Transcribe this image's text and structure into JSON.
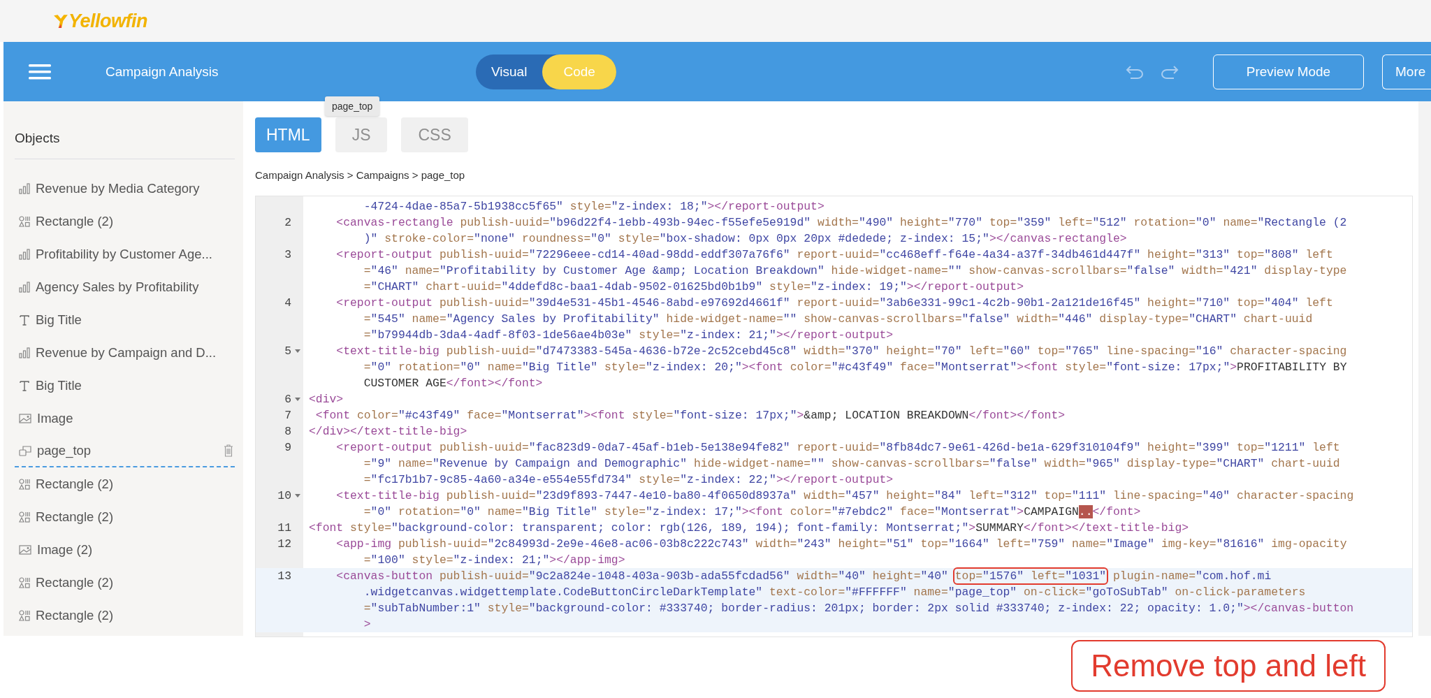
{
  "brand": {
    "logo": "Yellowfin"
  },
  "toolbar": {
    "title": "Campaign Analysis",
    "modes": [
      {
        "label": "Visual",
        "selected": false
      },
      {
        "label": "Code",
        "selected": true
      }
    ],
    "buttons": [
      "Preview Mode",
      "More"
    ]
  },
  "sidebar": {
    "heading": "Objects",
    "items": [
      {
        "label": "Revenue by Media Category",
        "kind": "chart",
        "selected": false
      },
      {
        "label": "Rectangle (2)",
        "kind": "shape",
        "selected": false
      },
      {
        "label": "Profitability by Customer Age...",
        "kind": "chart",
        "selected": false
      },
      {
        "label": "Agency Sales by Profitability",
        "kind": "chart",
        "selected": false
      },
      {
        "label": "Big Title",
        "kind": "text",
        "selected": false
      },
      {
        "label": "Revenue by Campaign and D...",
        "kind": "chart",
        "selected": false
      },
      {
        "label": "Big Title",
        "kind": "text",
        "selected": false
      },
      {
        "label": "Image",
        "kind": "image",
        "selected": false
      },
      {
        "label": "page_top",
        "kind": "button",
        "selected": true
      },
      {
        "label": "Rectangle (2)",
        "kind": "shape",
        "selected": false
      },
      {
        "label": "Rectangle (2)",
        "kind": "shape",
        "selected": false
      },
      {
        "label": "Image (2)",
        "kind": "image",
        "selected": false
      },
      {
        "label": "Rectangle (2)",
        "kind": "shape",
        "selected": false
      },
      {
        "label": "Rectangle (2)",
        "kind": "shape",
        "selected": false
      }
    ]
  },
  "editor": {
    "tabs": [
      {
        "label": "HTML",
        "selected": true
      },
      {
        "label": "JS",
        "selected": false
      },
      {
        "label": "CSS",
        "selected": false
      }
    ],
    "tooltip": "page_top",
    "breadcrumb": "Campaign Analysis > Campaigns > page_top",
    "lines": [
      {
        "continued": true,
        "fold": false,
        "current": false,
        "rows": [
          {
            "code": "        -4724-4dae-85a7-5b1938cc5f65\" style=\"z-index: 18;\"></report-output>"
          }
        ]
      },
      {
        "number": "2",
        "fold": false,
        "current": false,
        "rows": [
          {
            "code": "    <canvas-rectangle publish-uuid=\"b96d22f4-1ebb-493b-94ec-f55efe5e919d\" width=\"490\" height=\"770\" top=\"359\" left=\"512\" rotation=\"0\" name=\"Rectangle (2"
          },
          {
            "code": "        )\" stroke-color=\"none\" roundness=\"0\" style=\"box-shadow: 0px 0px 20px #dedede; z-index: 15;\"></canvas-rectangle>"
          }
        ]
      },
      {
        "number": "3",
        "fold": false,
        "current": false,
        "rows": [
          {
            "code": "    <report-output publish-uuid=\"72296eee-cd14-40ad-98dd-eddf307a76f6\" report-uuid=\"cc468eff-f64e-4a34-a37f-34db461d447f\" height=\"313\" top=\"808\" left"
          },
          {
            "code": "        =\"46\" name=\"Profitability by Customer Age &amp; Location Breakdown\" hide-widget-name=\"\" show-canvas-scrollbars=\"false\" width=\"421\" display-type"
          },
          {
            "code": "        =\"CHART\" chart-uuid=\"4ddefd8c-baa1-4dab-9502-01625bd0b1b9\" style=\"z-index: 19;\"></report-output>"
          }
        ]
      },
      {
        "number": "4",
        "fold": false,
        "current": false,
        "rows": [
          {
            "code": "    <report-output publish-uuid=\"39d4e531-45b1-4546-8abd-e97692d4661f\" report-uuid=\"3ab6e331-99c1-4c2b-90b1-2a121de16f45\" height=\"710\" top=\"404\" left"
          },
          {
            "code": "        =\"545\" name=\"Agency Sales by Profitability\" hide-widget-name=\"\" show-canvas-scrollbars=\"false\" width=\"446\" display-type=\"CHART\" chart-uuid"
          },
          {
            "code": "        =\"b79944db-3da4-4adf-8f03-1de56ae4b03e\" style=\"z-index: 21;\"></report-output>"
          }
        ]
      },
      {
        "number": "5",
        "fold": true,
        "current": false,
        "rows": [
          {
            "code": "    <text-title-big publish-uuid=\"d7473383-545a-4636-b72e-2c52cebd45c8\" width=\"370\" height=\"70\" left=\"60\" top=\"765\" line-spacing=\"16\" character-spacing"
          },
          {
            "code": "        =\"0\" rotation=\"0\" name=\"Big Title\" style=\"z-index: 20;\"><font color=\"#c43f49\" face=\"Montserrat\"><font style=\"font-size: 17px;\">PROFITABILITY BY"
          },
          {
            "code": "        CUSTOMER AGE</font></font>"
          }
        ]
      },
      {
        "number": "6",
        "fold": true,
        "current": false,
        "rows": [
          {
            "code": "<div>"
          }
        ]
      },
      {
        "number": "7",
        "fold": false,
        "current": false,
        "rows": [
          {
            "code": " <font color=\"#c43f49\" face=\"Montserrat\"><font style=\"font-size: 17px;\">&amp; LOCATION BREAKDOWN</font></font>"
          }
        ]
      },
      {
        "number": "8",
        "fold": false,
        "current": false,
        "rows": [
          {
            "code": "</div></text-title-big>"
          }
        ]
      },
      {
        "number": "9",
        "fold": false,
        "current": false,
        "rows": [
          {
            "code": "    <report-output publish-uuid=\"fac823d9-0da7-45af-b1eb-5e138e94fe82\" report-uuid=\"8fb84dc7-9e61-426d-be1a-629f310104f9\" height=\"399\" top=\"1211\" left"
          },
          {
            "code": "        =\"9\" name=\"Revenue by Campaign and Demographic\" hide-widget-name=\"\" show-canvas-scrollbars=\"false\" width=\"965\" display-type=\"CHART\" chart-uuid"
          },
          {
            "code": "        =\"fc17b1b7-9c85-4a60-a34e-e554e55fd734\" style=\"z-index: 22;\"></report-output>"
          }
        ]
      },
      {
        "number": "10",
        "fold": true,
        "current": false,
        "rows": [
          {
            "code": "    <text-title-big publish-uuid=\"23d9f893-7447-4e10-ba80-4f0650d8937a\" width=\"457\" height=\"84\" left=\"312\" top=\"111\" line-spacing=\"40\" character-spacing"
          },
          {
            "code": "        =\"0\" rotation=\"0\" name=\"Big Title\" style=\"z-index: 17;\"><font color=\"#7ebdc2\" face=\"Montserrat\">CAMPAIGN",
            "marked": "..",
            "after": "</font>"
          }
        ]
      },
      {
        "number": "11",
        "fold": false,
        "current": false,
        "rows": [
          {
            "code": "<font style=\"background-color: transparent; color: rgb(126, 189, 194); font-family: Montserrat;\">SUMMARY</font></text-title-big>"
          }
        ]
      },
      {
        "number": "12",
        "fold": false,
        "current": false,
        "rows": [
          {
            "code": "    <app-img publish-uuid=\"2c84993d-2e9e-46e8-ac06-03b8c222c743\" width=\"243\" height=\"51\" top=\"1664\" left=\"759\" name=\"Image\" img-key=\"81616\" img-opacity"
          },
          {
            "code": "        =\"100\" style=\"z-index: 21;\"></app-img>"
          }
        ]
      },
      {
        "number": "13",
        "fold": false,
        "current": true,
        "rows": [
          {
            "code": "    <canvas-button publish-uuid=\"9c2a824e-1048-403a-903b-ada55fcdad56\" width=\"40\" height=\"40\" ",
            "boxed": "top=\"1576\" left=\"1031\"",
            "after": " plugin-name=\"com.hof.mi"
          },
          {
            "code": "        .widgetcanvas.widgettemplate.CodeButtonCircleDarkTemplate\" text-color=\"#FFFFFF\" name=\"page_top\" on-click=\"goToSubTab\" on-click-parameters"
          },
          {
            "code": "        =\"subTabNumber:1\" style=\"background-color: #333740; border-radius: 201px; border: 2px solid #333740; z-index: 22; opacity: 1.0;\"></canvas-button"
          },
          {
            "code": "        >"
          }
        ]
      }
    ]
  },
  "annotation": "Remove top and left"
}
